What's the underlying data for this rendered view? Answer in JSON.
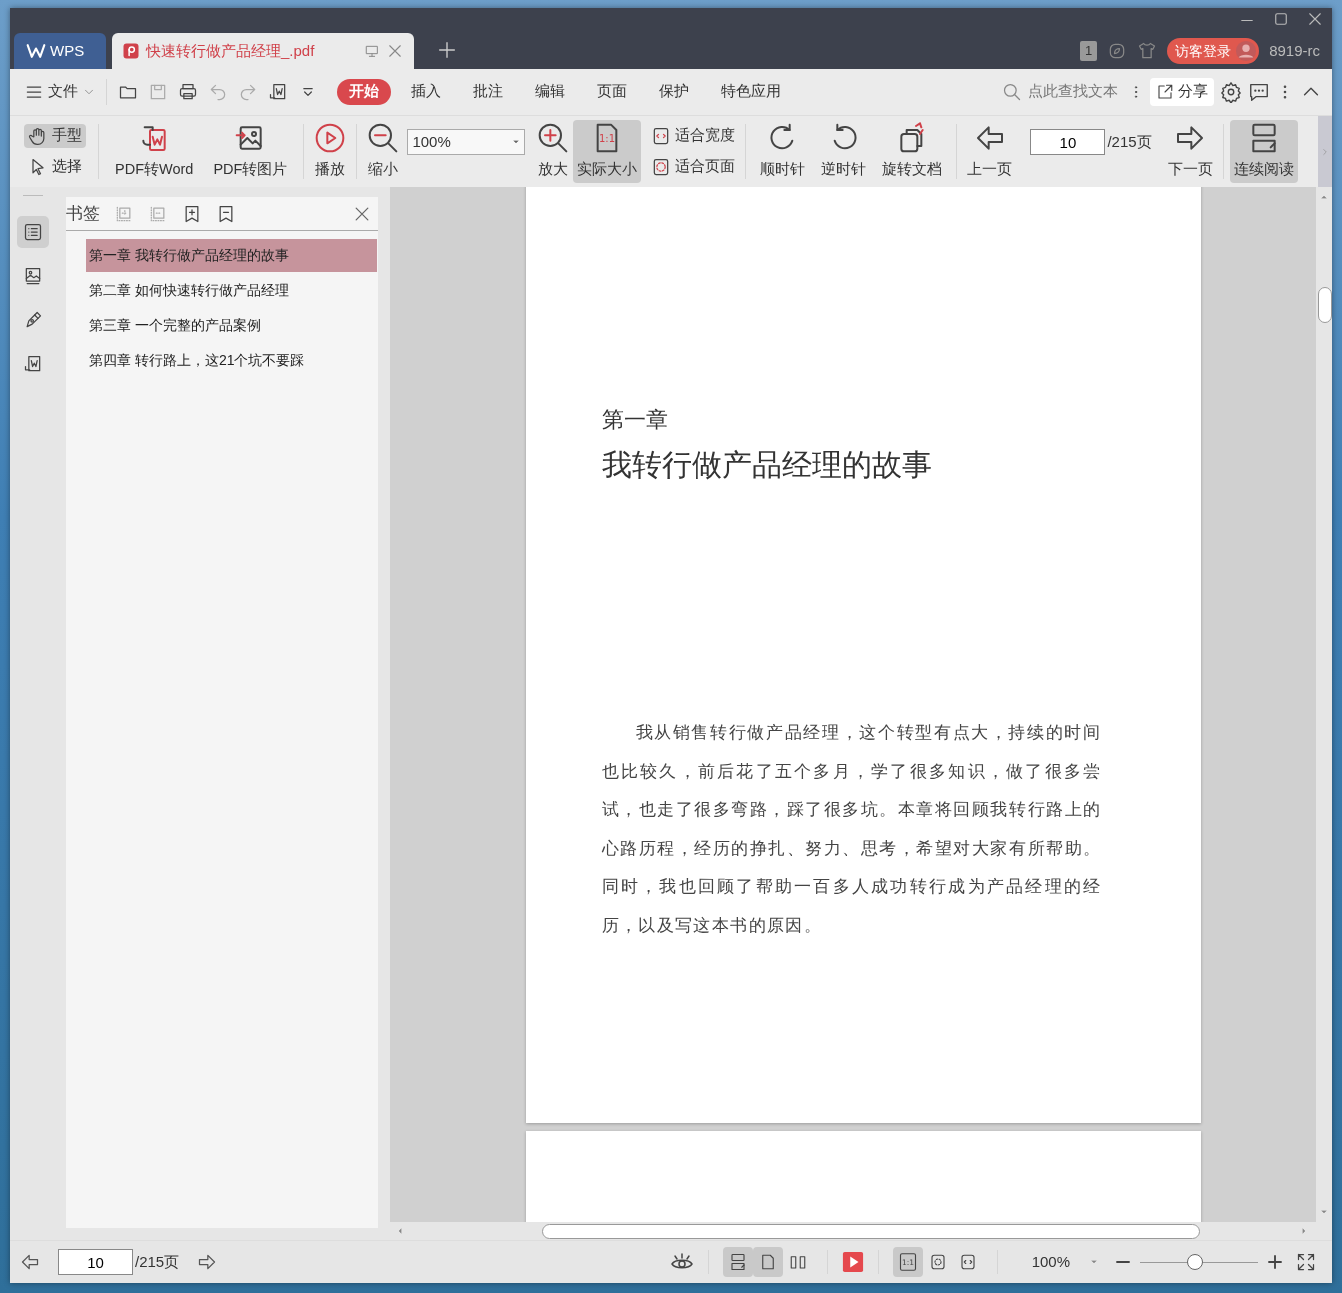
{
  "tabs": [
    {
      "kind": "home",
      "label": "WPS",
      "selected": false
    },
    {
      "kind": "document",
      "label": "快速转行做产品经理_.pdf",
      "selected": true
    }
  ],
  "title_bar": {
    "window_badge": "1",
    "login_button": "访客登录",
    "user_id": "8919-rc"
  },
  "menu_bar": {
    "file_menu": "文件",
    "ribbon_tabs": [
      {
        "label": "开始",
        "selected": true
      },
      {
        "label": "插入",
        "selected": false
      },
      {
        "label": "批注",
        "selected": false
      },
      {
        "label": "编辑",
        "selected": false
      },
      {
        "label": "页面",
        "selected": false
      },
      {
        "label": "保护",
        "selected": false
      },
      {
        "label": "特色应用",
        "selected": false
      }
    ],
    "search": {
      "placeholder": "点此查找文本"
    },
    "share_button": "分享"
  },
  "toolbar": {
    "mode_tools": [
      {
        "kind": "hand",
        "label": "手型",
        "selected": true
      },
      {
        "kind": "select",
        "label": "选择",
        "selected": false
      }
    ],
    "convert_buttons": [
      {
        "kind": "word",
        "label": "PDF转Word"
      },
      {
        "kind": "image",
        "label": "PDF转图片"
      }
    ],
    "play_button": "播放",
    "zoom_out": "缩小",
    "zoom_value": "100%",
    "zoom_in": "放大",
    "actual_size": {
      "label": "实际大小",
      "icon_text": "1:1",
      "selected": true
    },
    "fit_options": [
      {
        "kind": "width",
        "label": "适合宽度"
      },
      {
        "kind": "page",
        "label": "适合页面"
      }
    ],
    "rotate_buttons": [
      {
        "kind": "cw",
        "label": "顺时针"
      },
      {
        "kind": "ccw",
        "label": "逆时针"
      },
      {
        "kind": "doc",
        "label": "旋转文档"
      }
    ],
    "prev_page": "上一页",
    "page_input": "10",
    "page_total": "/215页",
    "next_page": "下一页",
    "continuous_read": {
      "label": "连续阅读",
      "selected": true
    }
  },
  "side_rail": [
    {
      "kind": "outline",
      "selected": true
    },
    {
      "kind": "thumbnail",
      "selected": false
    },
    {
      "kind": "annotate",
      "selected": false
    },
    {
      "kind": "convert",
      "selected": false
    }
  ],
  "sidebar": {
    "title": "书签",
    "bookmarks": [
      {
        "label": "第一章 我转行做产品经理的故事",
        "selected": true
      },
      {
        "label": "第二章 如何快速转行做产品经理",
        "selected": false
      },
      {
        "label": "第三章 一个完整的产品案例",
        "selected": false
      },
      {
        "label": "第四章 转行路上，这21个坑不要踩",
        "selected": false
      }
    ]
  },
  "document": {
    "chapter_label": "第一章",
    "chapter_title": "我转行做产品经理的故事",
    "body": "我从销售转行做产品经理，这个转型有点大，持续的时间也比较久，前后花了五个多月，学了很多知识，做了很多尝试，也走了很多弯路，踩了很多坑。本章将回顾我转行路上的心路历程，经历的挣扎、努力、思考，希望对大家有所帮助。同时，我也回顾了帮助一百多人成功转行成为产品经理的经历，以及写这本书的原因。"
  },
  "status_bar": {
    "page_input": "10",
    "page_total": "/215页",
    "view_modes": [
      {
        "kind": "continuous",
        "selected": true
      },
      {
        "kind": "single",
        "selected": true
      },
      {
        "kind": "double",
        "selected": false
      }
    ],
    "fit_modes": [
      {
        "kind": "actual",
        "icon_text": "1:1",
        "selected": true
      },
      {
        "kind": "page",
        "selected": false
      },
      {
        "kind": "width",
        "selected": false
      }
    ],
    "zoom_value": "100%",
    "zoom_slider": {
      "level": 0.47
    }
  }
}
